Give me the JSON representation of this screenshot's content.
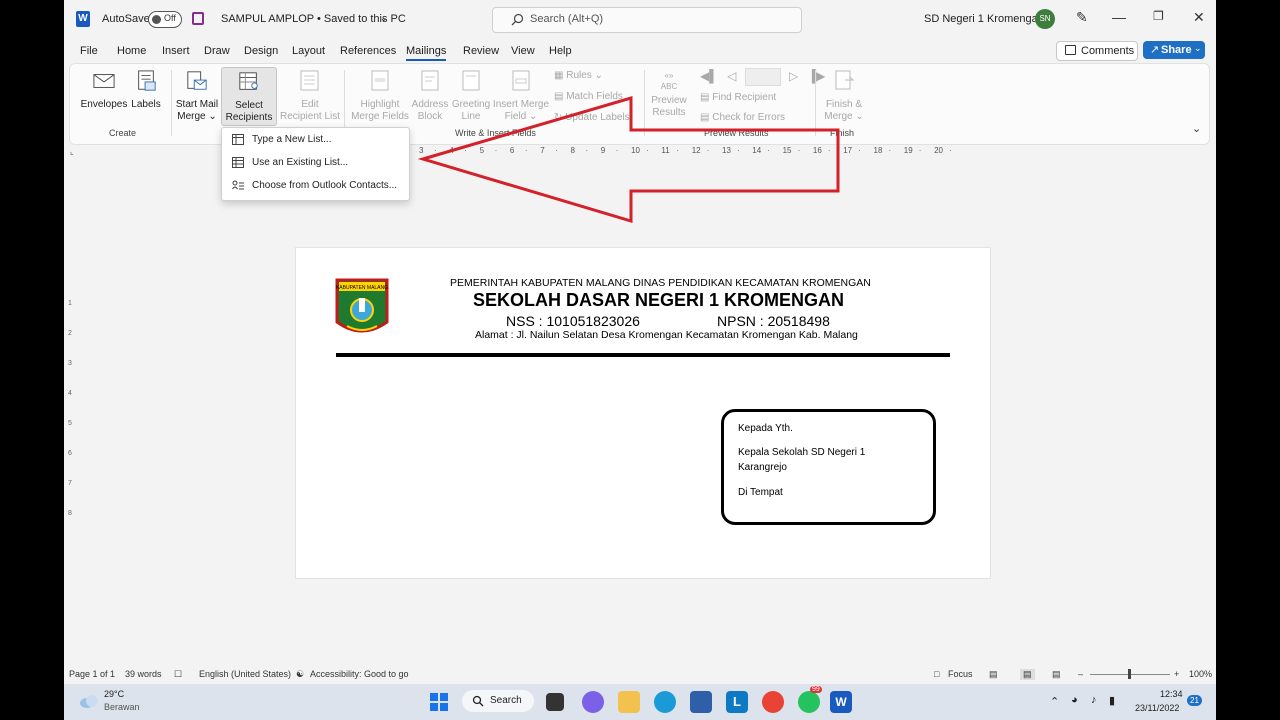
{
  "titlebar": {
    "autosave_label": "AutoSave",
    "autosave_state": "Off",
    "document_title": "SAMPUL AMPLOP • Saved to this PC",
    "search_placeholder": "Search (Alt+Q)",
    "user_name": "SD Negeri 1 Kromengan",
    "user_initials": "SN"
  },
  "menu": {
    "tabs": [
      "File",
      "Home",
      "Insert",
      "Draw",
      "Design",
      "Layout",
      "References",
      "Mailings",
      "Review",
      "View",
      "Help"
    ],
    "active_tab": "Mailings",
    "comments_label": "Comments",
    "share_label": "Share"
  },
  "ribbon": {
    "create": {
      "group_label": "Create",
      "envelopes": "Envelopes",
      "labels": "Labels"
    },
    "start": {
      "start_mail_merge_1": "Start Mail",
      "start_mail_merge_2": "Merge",
      "select_recipients_1": "Select",
      "select_recipients_2": "Recipients",
      "edit_list_1": "Edit",
      "edit_list_2": "Recipient List"
    },
    "write_insert": {
      "group_label": "Write & Insert Fields",
      "highlight_1": "Highlight",
      "highlight_2": "Merge Fields",
      "address_1": "Address",
      "address_2": "Block",
      "greeting_1": "Greeting",
      "greeting_2": "Line",
      "insert_1": "Insert Merge",
      "insert_2": "Field",
      "rules": "Rules",
      "match_fields": "Match Fields",
      "update_labels": "Update Labels"
    },
    "preview": {
      "group_label": "Preview Results",
      "preview_1": "Preview",
      "preview_2": "Results",
      "abc": "ABC",
      "find_recipient": "Find Recipient",
      "check_errors": "Check for Errors"
    },
    "finish": {
      "group_label": "Finish",
      "finish_1": "Finish &",
      "finish_2": "Merge"
    }
  },
  "dropdown": {
    "items": [
      "Type a New List...",
      "Use an Existing List...",
      "Choose from Outlook Contacts..."
    ]
  },
  "ruler": {
    "marks": [
      "3",
      "4",
      "5",
      "6",
      "7",
      "8",
      "9",
      "10",
      "11",
      "12",
      "13",
      "14",
      "15",
      "16",
      "17",
      "18",
      "19",
      "20"
    ]
  },
  "vruler": {
    "marks": [
      "1",
      "2",
      "3",
      "4",
      "5",
      "6",
      "7",
      "8"
    ]
  },
  "document": {
    "logo_text": "KABUPATEN MALANG",
    "header_line1": "PEMERINTAH KABUPATEN MALANG DINAS PENDIDIKAN KECAMATAN KROMENGAN",
    "header_line2": "SEKOLAH DASAR NEGERI 1 KROMENGAN",
    "nss": "NSS : 101051823026",
    "npsn": "NPSN : 20518498",
    "alamat": "Alamat : Jl. Nailun Selatan Desa Kromengan Kecamatan  Kromengan Kab. Malang",
    "address": {
      "line1": "Kepada Yth.",
      "line2": "Kepala Sekolah SD Negeri 1",
      "line3": "Karangrejo",
      "line4": "Di Tempat"
    }
  },
  "statusbar": {
    "page": "Page 1 of 1",
    "words": "39 words",
    "language": "English (United States)",
    "accessibility": "Accessibility: Good to go",
    "focus": "Focus",
    "zoom": "100%"
  },
  "taskbar": {
    "weather_temp": "29°C",
    "weather_desc": "Berawan",
    "search_label": "Search",
    "time": "12:34",
    "date": "23/11/2022",
    "notif_count": "21",
    "badge_whatsapp": "99"
  }
}
